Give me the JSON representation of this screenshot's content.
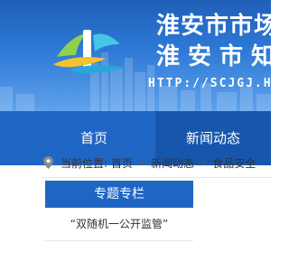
{
  "header": {
    "title_line1": "淮安市市场",
    "title_line2": "淮安市知",
    "url_text": "HTTP://SCJGJ.H"
  },
  "nav": {
    "items": [
      {
        "label": "首页"
      },
      {
        "label": "新闻动态"
      }
    ]
  },
  "breadcrumb": {
    "prefix": "当前位置:",
    "items": [
      "首页",
      "新闻动态",
      "食品安全"
    ],
    "separator": ">"
  },
  "sidebar": {
    "heading": "专题专栏",
    "items": [
      {
        "label": "“双随机一公开监管”"
      }
    ]
  },
  "colors": {
    "nav_blue": "#1f66c4",
    "nav_active": "#1657ad",
    "banner_top": "#1f5fb8"
  }
}
